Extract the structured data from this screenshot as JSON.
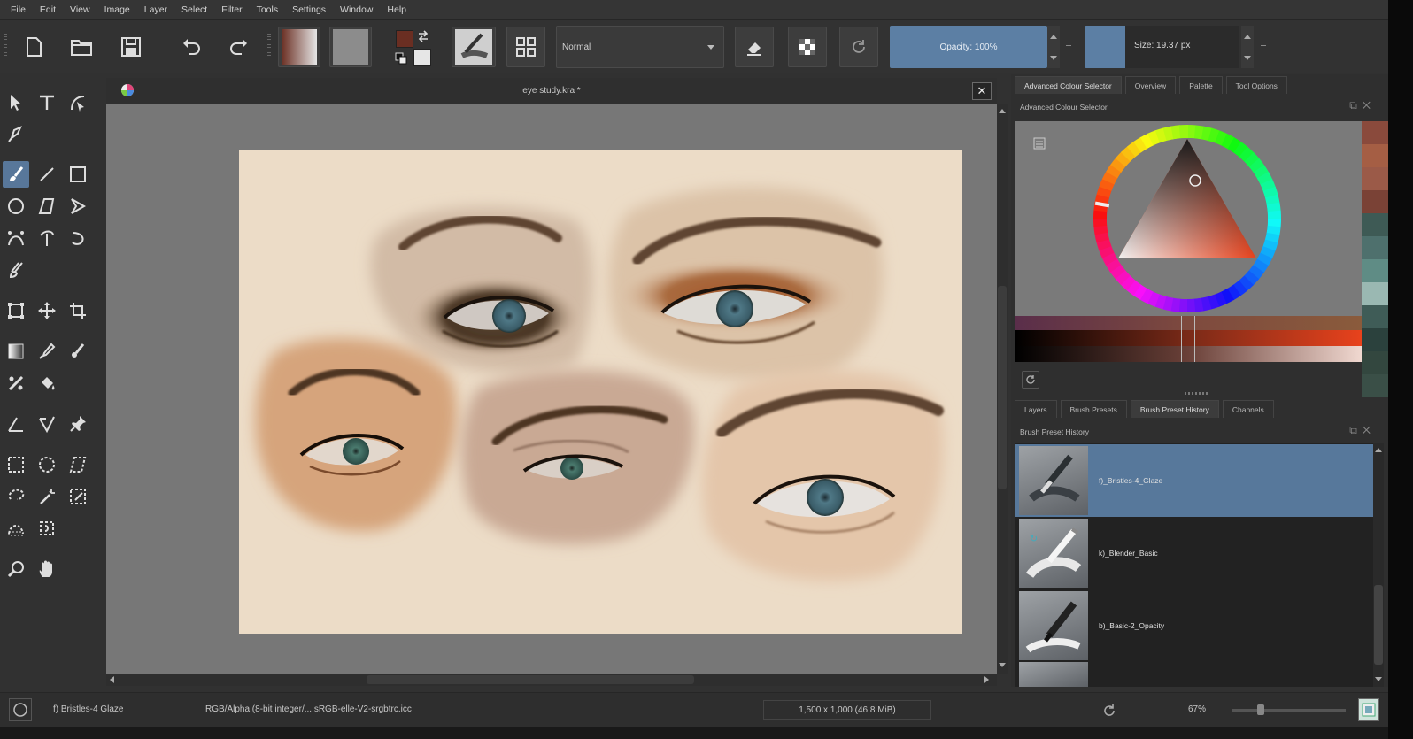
{
  "menu": [
    "File",
    "Edit",
    "View",
    "Image",
    "Layer",
    "Select",
    "Filter",
    "Tools",
    "Settings",
    "Window",
    "Help"
  ],
  "toolbar": {
    "blend_mode": "Normal",
    "opacity_label": "Opacity: 100%",
    "opacity_value": 1.0,
    "size_label": "Size: 19.37 px",
    "fg_color": "#6a2e22",
    "bg_color": "#e6e6e6"
  },
  "document": {
    "title": "eye study.kra *",
    "canvas_color": "#ecdcc7"
  },
  "toolbox": {
    "active_tool": "freehand-brush"
  },
  "right_panel": {
    "top_tabs": [
      "Advanced Colour Selector",
      "Overview",
      "Palette",
      "Tool Options"
    ],
    "color_selector_title": "Advanced Colour Selector",
    "bottom_tabs": [
      "Layers",
      "Brush Presets",
      "Brush Preset History",
      "Channels"
    ],
    "history_title": "Brush Preset History",
    "history_items": [
      {
        "name": "f)_Bristles-4_Glaze",
        "selected": true
      },
      {
        "name": "k)_Blender_Basic",
        "selected": false
      },
      {
        "name": "b)_Basic-2_Opacity",
        "selected": false
      }
    ],
    "swatches": [
      "#8a4a3c",
      "#a55e44",
      "#9b5a48",
      "#7a4236",
      "#3e5a55",
      "#4e706d",
      "#5f8c85",
      "#9ab8b2",
      "#3f5c57",
      "#2b413d",
      "#33473f",
      "#3a4f47"
    ]
  },
  "status": {
    "brush": "f) Bristles-4 Glaze",
    "color_model": "RGB/Alpha (8-bit integer/... sRGB-elle-V2-srgbtrc.icc",
    "dimensions": "1,500 x 1,000 (46.8 MiB)",
    "zoom": "67%"
  }
}
